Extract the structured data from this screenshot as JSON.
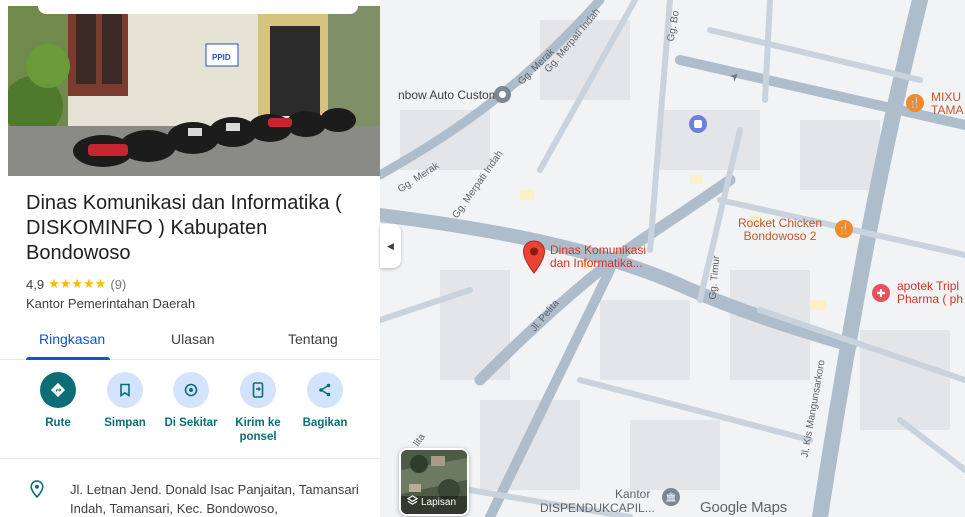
{
  "place": {
    "title": "Dinas Komunikasi dan Informatika ( DISKOMINFO ) Kabupaten Bondowoso",
    "rating": "4,9",
    "stars": "★★★★★",
    "reviews": "(9)",
    "category": "Kantor Pemerintahan Daerah",
    "photo_sign": "PPID",
    "address": "Jl. Letnan Jend. Donald Isac Panjaitan, Tamansari Indah, Tamansari, Kec. Bondowoso,"
  },
  "tabs": [
    {
      "label": "Ringkasan",
      "active": true
    },
    {
      "label": "Ulasan",
      "active": false
    },
    {
      "label": "Tentang",
      "active": false
    }
  ],
  "actions": [
    {
      "label": "Rute",
      "icon": "directions-icon"
    },
    {
      "label": "Simpan",
      "icon": "bookmark-icon"
    },
    {
      "label": "Di Sekitar",
      "icon": "nearby-icon"
    },
    {
      "label": "Kirim ke ponsel",
      "icon": "send-to-phone-icon"
    },
    {
      "label": "Bagikan",
      "icon": "share-icon"
    }
  ],
  "map": {
    "pin_label_line1": "Dinas Komunikasi",
    "pin_label_line2": "dan Informatika...",
    "labels": {
      "auto_custom": "nbow Auto Custom",
      "rocket_chicken_1": "Rocket Chicken",
      "rocket_chicken_2": "Bondowoso 2",
      "apotek_1": "apotek Tripl",
      "apotek_2": "Pharma ( ph",
      "mixu_1": "MIXU",
      "mixu_2": "TAMA",
      "kantor": "Kantor",
      "dispenduk": "DISPENDUKCAPIL..."
    },
    "streets": {
      "gg_merak_1": "Gg. Merak",
      "gg_merpati_1": "Gg. Merpati Indah",
      "gg_merak_2": "Gg. Merak",
      "gg_merpati_2": "Gg. Merpati Indah",
      "gg_bo": "Gg. Bo",
      "gg_timur": "Gg. Timur",
      "jl_pelita": "Jl. Pelita",
      "jl_kis": "Jl. Kis Mangunsarkoro",
      "lita": "lita"
    },
    "layers_label": "Lapisan",
    "logo": "Google Maps"
  },
  "colors": {
    "accent": "#0b57d0",
    "action_teal": "#0b6e76",
    "pin_red": "#ea4335",
    "star": "#fbbc04"
  }
}
